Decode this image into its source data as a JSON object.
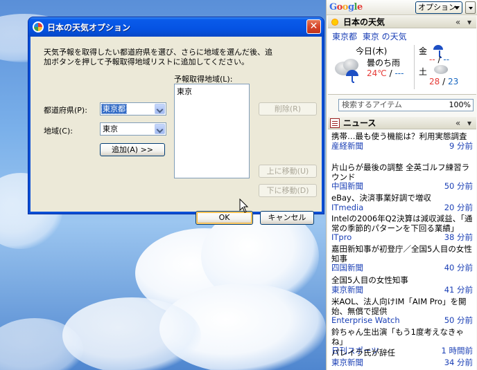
{
  "dialog": {
    "title": "日本の天気オプション",
    "close_glyph": "✕",
    "description": "天気予報を取得したい都道府県を選び、さらに地域を選んだ後、追加ボタンを押して予報取得地域リストに追加してください。",
    "prefecture_label": "都道府県(P):",
    "prefecture_value": "東京都",
    "area_label": "地域(C):",
    "area_value": "東京",
    "add_button": "追加(A) >>",
    "list_label": "予報取得地域(L):",
    "list_items": [
      "東京"
    ],
    "delete_button": "削除(R)",
    "move_up_button": "上に移動(U)",
    "move_down_button": "下に移動(D)",
    "ok_button": "OK",
    "cancel_button": "キャンセル"
  },
  "sidebar": {
    "logo": "Google",
    "options_button": "オプション",
    "weather": {
      "title": "日本の天気",
      "controls": "«  ▾",
      "location": "東京都",
      "location_link": "東京 の天気",
      "today_label": "今日(木)",
      "today_condition": "曇のち雨",
      "today_high": "24℃",
      "today_sep": "/",
      "today_low": "---",
      "days": [
        {
          "day": "金",
          "high": "--",
          "sep": "/",
          "low": "--"
        },
        {
          "day": "土",
          "high": "28",
          "sep": "/",
          "low": "23"
        }
      ]
    },
    "search": {
      "placeholder": "検索するアイテム",
      "percent": "100%"
    },
    "news": {
      "title": "ニュース",
      "controls": "«  ▾",
      "items": [
        {
          "headline": "携帯…最も使う機能は？利用実態調査",
          "source": "産経新聞",
          "time": "9 分前"
        },
        {
          "headline": "片山らが最後の調整 全英ゴルフ練習ラウンド",
          "source": "中国新聞",
          "time": "50 分前"
        },
        {
          "headline": "eBay、決済事業好調で増収",
          "source": "ITmedia",
          "time": "20 分前"
        },
        {
          "headline": "Intelの2006年Q2決算は減収減益、「通常の季節的パターンを下回る業績」",
          "source": "ITpro",
          "time": "38 分前"
        },
        {
          "headline": "嘉田新知事が初登庁／全国5人目の女性知事",
          "source": "四国新聞",
          "time": "40 分前"
        },
        {
          "headline": "全国5人目の女性知事",
          "source": "東京新聞",
          "time": "41 分前"
        },
        {
          "headline": "米AOL、法人向けIM「AIM Pro」を開始、無償で提供",
          "source": "Enterprise Watch",
          "time": "50 分前"
        },
        {
          "headline": "鈴ちゃん生出演「もう1度考えなきゃね」",
          "source": "日刊スポーツ",
          "time": "1 時間前"
        },
        {
          "headline": "パレイラ氏が辞任",
          "source": "東京新聞",
          "time": "34 分前"
        }
      ]
    }
  }
}
